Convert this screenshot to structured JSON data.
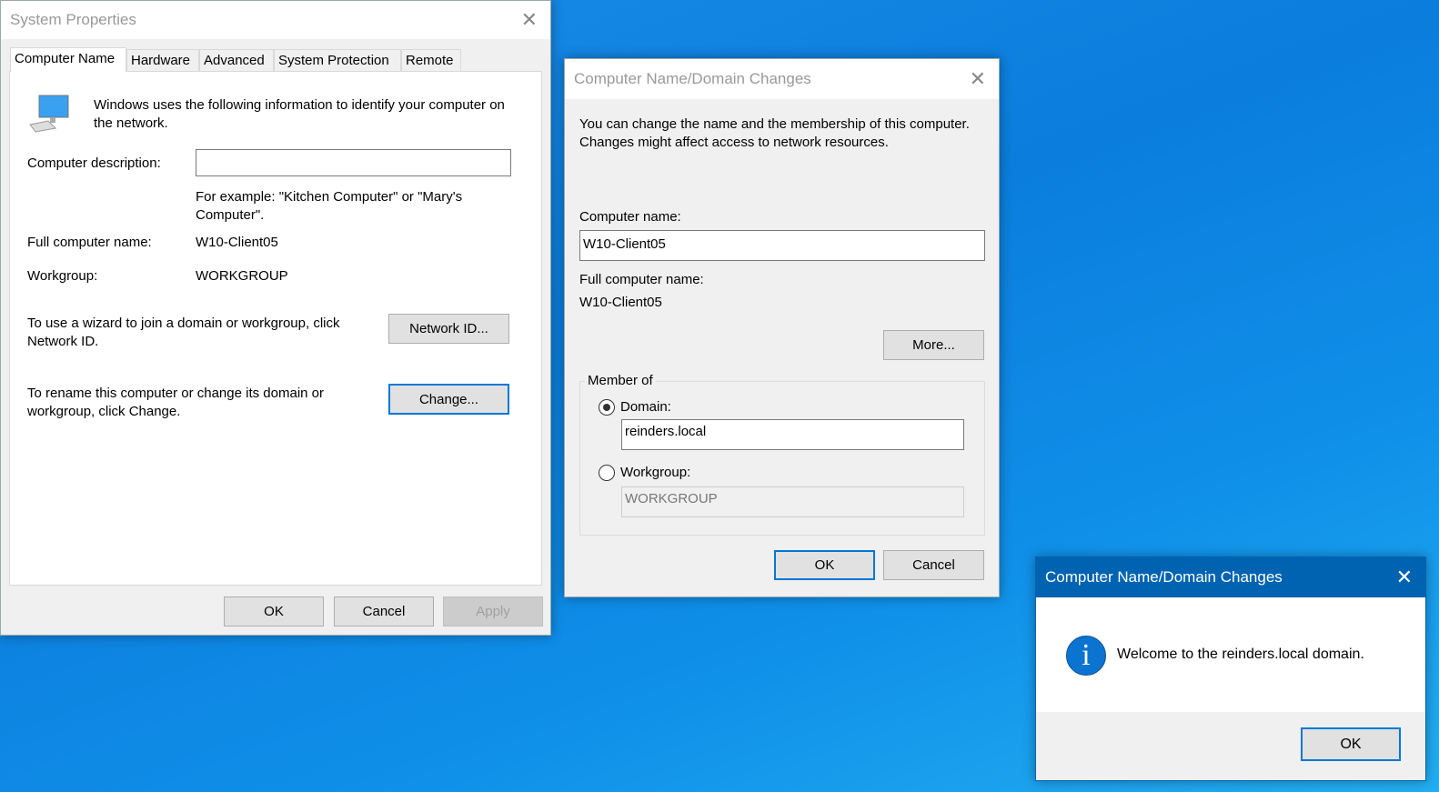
{
  "system_properties": {
    "title": "System Properties",
    "tabs": [
      "Computer Name",
      "Hardware",
      "Advanced",
      "System Protection",
      "Remote"
    ],
    "intro": "Windows uses the following information to identify your computer on the network.",
    "description_label": "Computer description:",
    "description_value": "",
    "example": "For example: \"Kitchen Computer\" or \"Mary's Computer\".",
    "full_name_label": "Full computer name:",
    "full_name_value": "W10-Client05",
    "workgroup_label": "Workgroup:",
    "workgroup_value": "WORKGROUP",
    "network_id_text": "To use a wizard to join a domain or workgroup, click Network ID.",
    "network_id_button": "Network ID...",
    "change_text": "To rename this computer or change its domain or workgroup, click Change.",
    "change_button": "Change...",
    "ok": "OK",
    "cancel": "Cancel",
    "apply": "Apply"
  },
  "domain_changes": {
    "title": "Computer Name/Domain Changes",
    "intro": "You can change the name and the membership of this computer. Changes might affect access to network resources.",
    "computer_name_label": "Computer name:",
    "computer_name_value": "W10-Client05",
    "full_name_label": "Full computer name:",
    "full_name_value": "W10-Client05",
    "more_button": "More...",
    "member_of": "Member of",
    "domain_label": "Domain:",
    "domain_value": "reinders.local",
    "workgroup_label": "Workgroup:",
    "workgroup_value": "WORKGROUP",
    "ok": "OK",
    "cancel": "Cancel"
  },
  "welcome": {
    "title": "Computer Name/Domain Changes",
    "message": "Welcome to the reinders.local domain.",
    "ok": "OK"
  }
}
